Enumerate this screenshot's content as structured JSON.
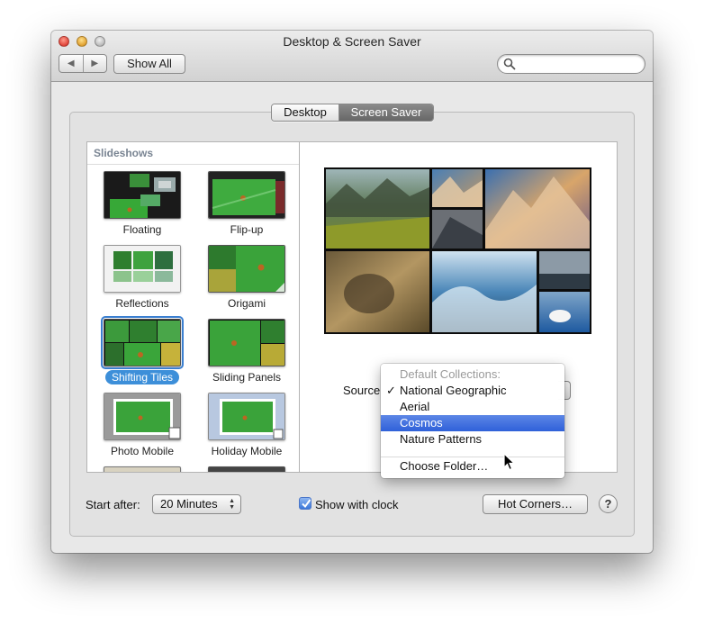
{
  "window": {
    "title": "Desktop & Screen Saver",
    "controls": [
      "close-icon",
      "minimize-icon",
      "zoom-icon"
    ]
  },
  "toolbar": {
    "back_icon": "◀",
    "forward_icon": "▶",
    "show_all": "Show All",
    "search": {
      "placeholder": "",
      "value": ""
    }
  },
  "tabs": {
    "desktop": "Desktop",
    "screen_saver": "Screen Saver",
    "active": "Screen Saver"
  },
  "slideshows": {
    "header": "Slideshows",
    "items": [
      {
        "label": "Floating",
        "icon": "floating-thumbnail"
      },
      {
        "label": "Flip-up",
        "icon": "flip-up-thumbnail"
      },
      {
        "label": "Reflections",
        "icon": "reflections-thumbnail"
      },
      {
        "label": "Origami",
        "icon": "origami-thumbnail"
      },
      {
        "label": "Shifting Tiles",
        "icon": "shifting-tiles-thumbnail",
        "selected": true
      },
      {
        "label": "Sliding Panels",
        "icon": "sliding-panels-thumbnail"
      },
      {
        "label": "Photo Mobile",
        "icon": "photo-mobile-thumbnail"
      },
      {
        "label": "Holiday Mobile",
        "icon": "holiday-mobile-thumbnail"
      }
    ]
  },
  "preview": {
    "image": "photo-mosaic-preview"
  },
  "source": {
    "label": "Source",
    "menu": {
      "header": "Default Collections:",
      "items": [
        "National Geographic",
        "Aerial",
        "Cosmos",
        "Nature Patterns"
      ],
      "checked": "National Geographic",
      "highlighted": "Cosmos",
      "choose_folder": "Choose Folder…",
      "checkmark": "✓"
    }
  },
  "bottom": {
    "start_after_label": "Start after:",
    "start_after_value": "20 Minutes",
    "show_clock_label": "Show with clock",
    "show_clock_checked": true,
    "hot_corners": "Hot Corners…",
    "help": "?"
  },
  "colors": {
    "selection_blue": "#3d8fd9",
    "menu_highlight": "#3a6ddc",
    "list_header": "#7a8593"
  }
}
